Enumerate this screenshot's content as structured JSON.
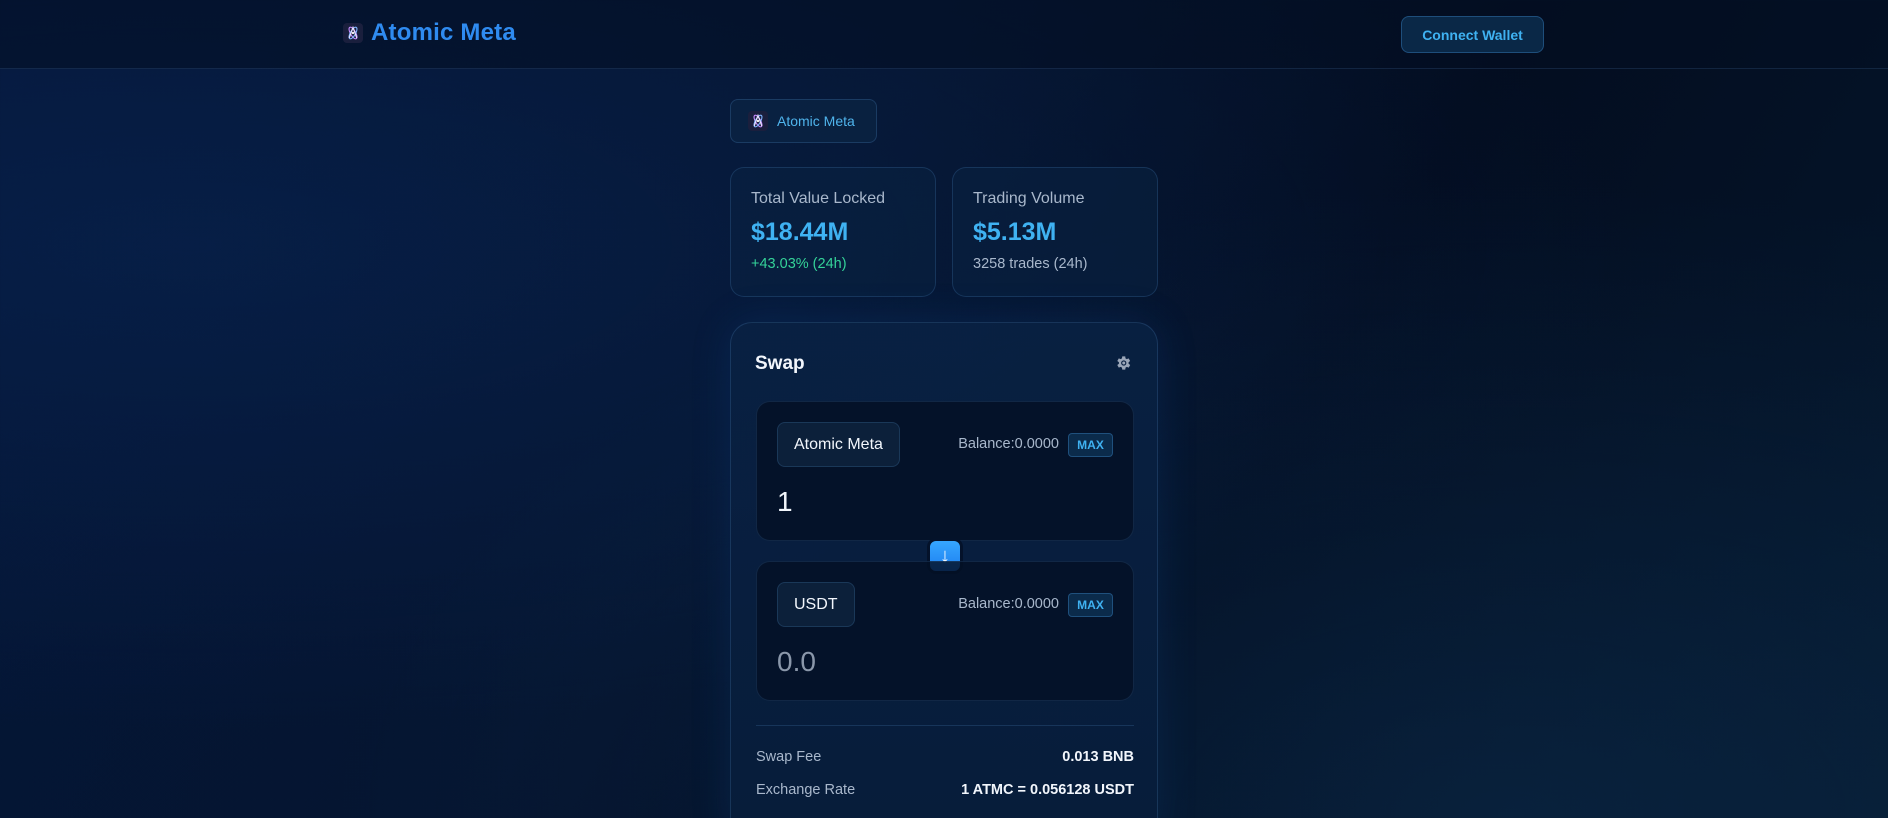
{
  "header": {
    "brand": "Atomic Meta",
    "connect_label": "Connect Wallet"
  },
  "chip": {
    "label": "Atomic Meta"
  },
  "stats": {
    "tvl": {
      "title": "Total Value Locked",
      "value": "$18.44M",
      "change": "+43.03% (24h)"
    },
    "volume": {
      "title": "Trading Volume",
      "value": "$5.13M",
      "trades": "3258 trades (24h)"
    }
  },
  "swap": {
    "title": "Swap",
    "from": {
      "token": "Atomic Meta",
      "balance": "Balance:0.0000",
      "max_label": "MAX",
      "amount": "1"
    },
    "to": {
      "token": "USDT",
      "balance": "Balance:0.0000",
      "max_label": "MAX",
      "amount_placeholder": "0.0"
    },
    "arrow": "↓",
    "details": [
      {
        "label": "Swap Fee",
        "value": "0.013 BNB"
      },
      {
        "label": "Exchange Rate",
        "value": "1 ATMC = 0.056128 USDT"
      }
    ]
  },
  "colors": {
    "accent": "#3fb2f2",
    "brand": "#2f8bf0",
    "positive": "#34d399",
    "background": "#041638"
  },
  "icons": {
    "logo": "atom-logo-icon",
    "settings": "gear-icon",
    "swap_direction": "arrow-down-icon"
  }
}
